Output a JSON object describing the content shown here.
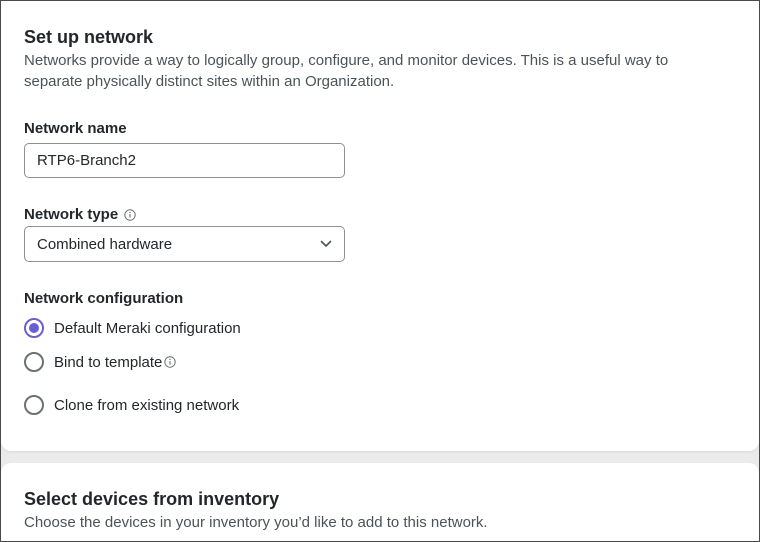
{
  "setup": {
    "title": "Set up network",
    "description": "Networks provide a way to logically group, configure, and monitor devices. This is a useful way to separate physically distinct sites within an Organization.",
    "network_name": {
      "label": "Network name",
      "value": "RTP6-Branch2"
    },
    "network_type": {
      "label": "Network type",
      "info_icon": "info-icon",
      "selected": "Combined hardware",
      "dropdown_icon": "chevron-down-icon"
    },
    "network_configuration": {
      "label": "Network configuration",
      "options": [
        {
          "label": "Default Meraki configuration",
          "checked": true
        },
        {
          "label": "Bind to template",
          "checked": false,
          "info_icon": "info-icon"
        },
        {
          "label": "Clone from existing network",
          "checked": false
        }
      ]
    }
  },
  "devices": {
    "title": "Select devices from inventory",
    "description": "Choose the devices in your inventory you’d like to add to this network."
  },
  "colors": {
    "accent": "#6a5fcf",
    "border": "#8c9196",
    "text": "#23272b",
    "muted_text": "#4b5359",
    "background": "#ebebeb"
  }
}
